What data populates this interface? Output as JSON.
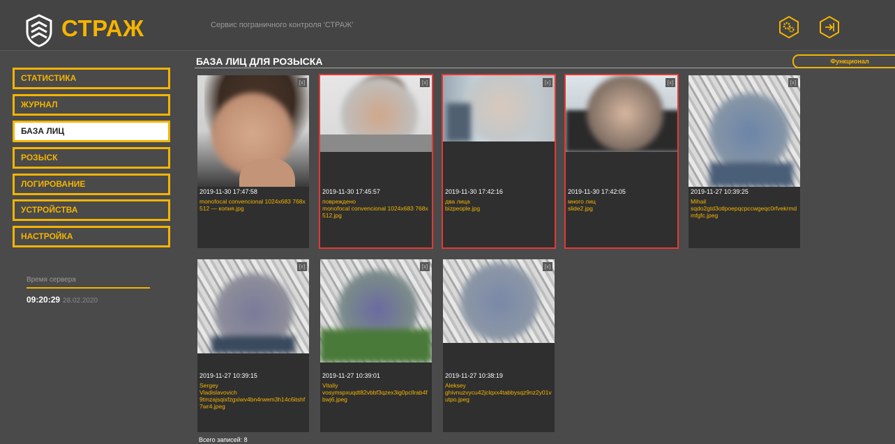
{
  "header": {
    "logo_text": "СТРАЖ",
    "service_title": "Сервис пограничного контроля 'СТРАЖ'"
  },
  "sidebar": {
    "items": [
      {
        "label": "СТАТИСТИКА",
        "active": false
      },
      {
        "label": "ЖУРНАЛ",
        "active": false
      },
      {
        "label": "БАЗА ЛИЦ",
        "active": true
      },
      {
        "label": "РОЗЫСК",
        "active": false
      },
      {
        "label": "ЛОГИРОВАНИЕ",
        "active": false
      },
      {
        "label": "УСТРОЙСТВА",
        "active": false
      },
      {
        "label": "НАСТРОЙКА",
        "active": false
      }
    ],
    "server_time_label": "Время сервера",
    "server_time": "09:20:29",
    "server_date": "28.02.2020"
  },
  "main": {
    "title": "БАЗА ЛИЦ ДЛЯ РОЗЫСКА",
    "func_button": "Функционал",
    "total": "Всего записей: 8",
    "close_label": "[x]",
    "cards": [
      {
        "timestamp": "2019-11-30 17:47:58",
        "lines": [
          "monofocal convencional 1024x683 768x512 — копия.jpg"
        ],
        "flagged": false
      },
      {
        "timestamp": "2019-11-30 17:45:57",
        "lines": [
          "повреждено",
          "monofocal convencional 1024x683 768x512.jpg"
        ],
        "flagged": true
      },
      {
        "timestamp": "2019-11-30 17:42:16",
        "lines": [
          "два лица",
          "bizpeople.jpg"
        ],
        "flagged": true
      },
      {
        "timestamp": "2019-11-30 17:42:05",
        "lines": [
          "много лиц",
          "slide2.jpg"
        ],
        "flagged": true
      },
      {
        "timestamp": "2019-11-27 10:39:25",
        "lines": [
          "Mihail",
          "sqdo2gtd3otlpoepqcpccwgeqc0rfvekrmdmfgfc.jpeg"
        ],
        "flagged": false
      },
      {
        "timestamp": "2019-11-27 10:39:15",
        "lines": [
          "Sergey",
          "Vladislavovich",
          "9tmzajsqixfzgxiwv4bn4rwem3h14c6itshf7wr4.jpeg"
        ],
        "flagged": false
      },
      {
        "timestamp": "2019-11-27 10:39:01",
        "lines": [
          "Vitaliy",
          "vosymspxuqdt82vbbf3qzex3ig0pcllrab4fbwj6.jpeg"
        ],
        "flagged": false
      },
      {
        "timestamp": "2019-11-27 10:38:19",
        "lines": [
          "Aleksey",
          "ghivnuzvycu42jclqxx4tabbysqz9nz2y01vutpo.jpeg"
        ],
        "flagged": false
      }
    ]
  },
  "colors": {
    "accent": "#f5b400",
    "flag_border": "#e53935",
    "background": "#4a4a4a",
    "card": "#2f2f2f"
  }
}
